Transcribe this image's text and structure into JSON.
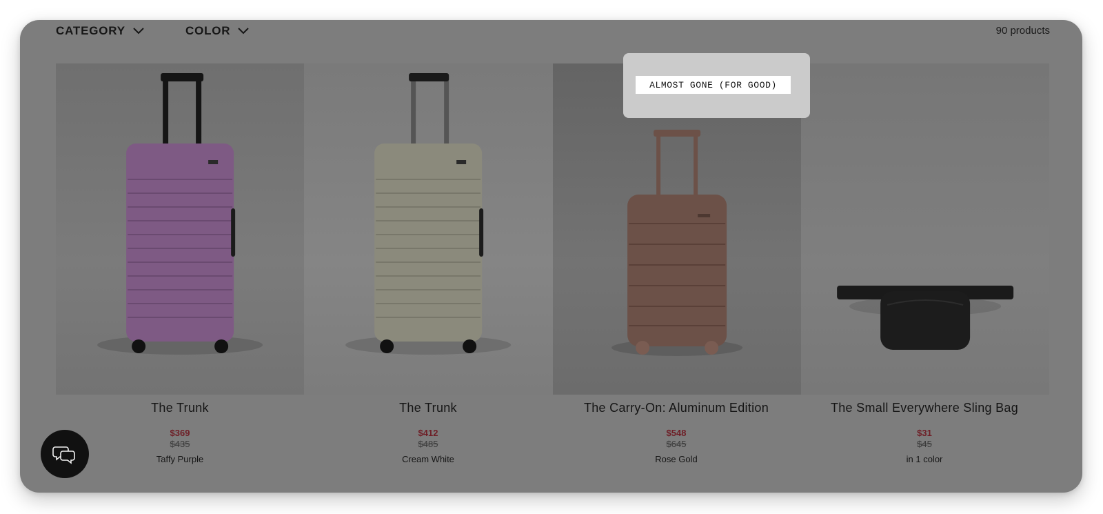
{
  "filters": {
    "category_label": "CATEGORY",
    "color_label": "COLOR",
    "chevron_icon": "chevron-down-icon"
  },
  "product_count": "90 products",
  "badge": {
    "label": "ALMOST GONE (FOR GOOD)"
  },
  "products": [
    {
      "name": "The Trunk",
      "sale_price": "$369",
      "original_price": "$435",
      "variant": "Taffy Purple",
      "color": "#7e5a84"
    },
    {
      "name": "The Trunk",
      "sale_price": "$412",
      "original_price": "$485",
      "variant": "Cream White",
      "color": "#8b8a7c"
    },
    {
      "name": "The Carry-On: Aluminum Edition",
      "sale_price": "$548",
      "original_price": "$645",
      "variant": "Rose Gold",
      "color": "#6c5148"
    },
    {
      "name": "The Small Everywhere Sling Bag",
      "sale_price": "$31",
      "original_price": "$45",
      "variant": "in 1 color",
      "color": "#1c1c1c"
    }
  ],
  "colors": {
    "overlay": "#7d7d7d",
    "sale_price": "#6e1e26",
    "chat_button": "#111111"
  },
  "chat": {
    "icon": "chat-bubbles-icon"
  }
}
